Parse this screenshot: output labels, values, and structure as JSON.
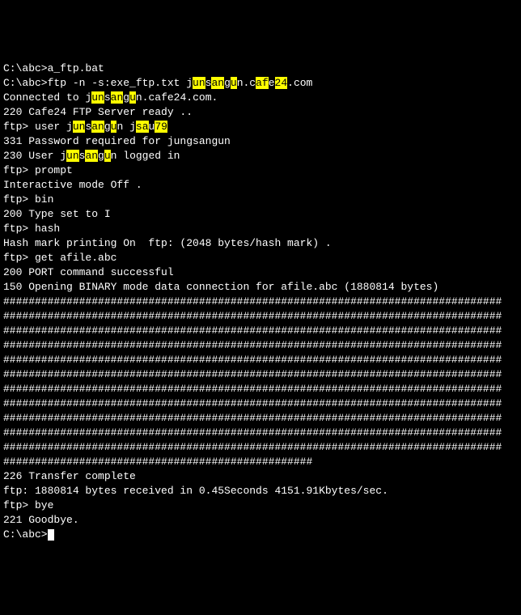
{
  "lines": [
    {
      "segs": [
        {
          "t": "C:\\abc>a_ftp.bat"
        }
      ]
    },
    {
      "segs": [
        {
          "t": ""
        }
      ]
    },
    {
      "segs": [
        {
          "t": "C:\\abc>ftp -n -s:exe_ftp.txt j"
        },
        {
          "t": "un",
          "hl": true
        },
        {
          "t": "s"
        },
        {
          "t": "an",
          "hl": true
        },
        {
          "t": "g"
        },
        {
          "t": "u",
          "hl": true
        },
        {
          "t": "n.c"
        },
        {
          "t": "af",
          "hl": true
        },
        {
          "t": "e"
        },
        {
          "t": "24",
          "hl": true
        },
        {
          "t": ".com"
        }
      ]
    },
    {
      "segs": [
        {
          "t": "Connected to j"
        },
        {
          "t": "un",
          "hl": true
        },
        {
          "t": "s"
        },
        {
          "t": "an",
          "hl": true
        },
        {
          "t": "g"
        },
        {
          "t": "u",
          "hl": true
        },
        {
          "t": "n.cafe24.com."
        }
      ]
    },
    {
      "segs": [
        {
          "t": "220 Cafe24 FTP Server ready .."
        }
      ]
    },
    {
      "segs": [
        {
          "t": "ftp> user j"
        },
        {
          "t": "un",
          "hl": true
        },
        {
          "t": "s"
        },
        {
          "t": "an",
          "hl": true
        },
        {
          "t": "g"
        },
        {
          "t": "u",
          "hl": true
        },
        {
          "t": "n j"
        },
        {
          "t": "sa",
          "hl": true
        },
        {
          "t": "u"
        },
        {
          "t": "79",
          "hl": true
        }
      ]
    },
    {
      "segs": [
        {
          "t": "331 Password required for jungsangun"
        }
      ]
    },
    {
      "segs": [
        {
          "t": "230 User j"
        },
        {
          "t": "un",
          "hl": true
        },
        {
          "t": "s"
        },
        {
          "t": "an",
          "hl": true
        },
        {
          "t": "g"
        },
        {
          "t": "u",
          "hl": true
        },
        {
          "t": "n logged in"
        }
      ]
    },
    {
      "segs": [
        {
          "t": "ftp> prompt"
        }
      ]
    },
    {
      "segs": [
        {
          "t": "Interactive mode Off ."
        }
      ]
    },
    {
      "segs": [
        {
          "t": "ftp> bin"
        }
      ]
    },
    {
      "segs": [
        {
          "t": "200 Type set to I"
        }
      ]
    },
    {
      "segs": [
        {
          "t": "ftp> hash"
        }
      ]
    },
    {
      "segs": [
        {
          "t": "Hash mark printing On  ftp: (2048 bytes/hash mark) ."
        }
      ]
    },
    {
      "segs": [
        {
          "t": "ftp> get afile.abc"
        }
      ]
    },
    {
      "segs": [
        {
          "t": "200 PORT command successful"
        }
      ]
    },
    {
      "segs": [
        {
          "t": "150 Opening BINARY mode data connection for afile.abc (1880814 bytes)"
        }
      ]
    },
    {
      "segs": [
        {
          "t": "###############################################################################"
        }
      ]
    },
    {
      "segs": [
        {
          "t": "###############################################################################"
        }
      ]
    },
    {
      "segs": [
        {
          "t": "###############################################################################"
        }
      ]
    },
    {
      "segs": [
        {
          "t": "###############################################################################"
        }
      ]
    },
    {
      "segs": [
        {
          "t": "###############################################################################"
        }
      ]
    },
    {
      "segs": [
        {
          "t": "###############################################################################"
        }
      ]
    },
    {
      "segs": [
        {
          "t": "###############################################################################"
        }
      ]
    },
    {
      "segs": [
        {
          "t": "###############################################################################"
        }
      ]
    },
    {
      "segs": [
        {
          "t": "###############################################################################"
        }
      ]
    },
    {
      "segs": [
        {
          "t": "###############################################################################"
        }
      ]
    },
    {
      "segs": [
        {
          "t": "###############################################################################"
        }
      ]
    },
    {
      "segs": [
        {
          "t": "#################################################"
        }
      ]
    },
    {
      "segs": [
        {
          "t": "226 Transfer complete"
        }
      ]
    },
    {
      "segs": [
        {
          "t": "ftp: 1880814 bytes received in 0.45Seconds 4151.91Kbytes/sec."
        }
      ]
    },
    {
      "segs": [
        {
          "t": "ftp> bye"
        }
      ]
    },
    {
      "segs": [
        {
          "t": "221 Goodbye."
        }
      ]
    },
    {
      "segs": [
        {
          "t": ""
        }
      ]
    },
    {
      "segs": [
        {
          "t": "C:\\abc>"
        }
      ],
      "cursor": true
    }
  ]
}
